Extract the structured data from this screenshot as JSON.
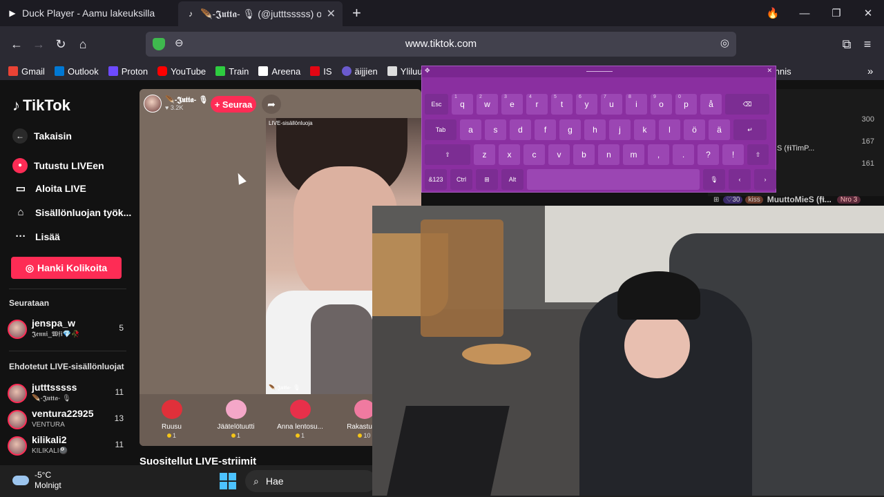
{
  "tabs": [
    {
      "title": "Duck Player - Aamu lakeuksilla",
      "icon": "play-icon"
    },
    {
      "title": "🪶-𝕵𝖚𝖙𝖙𝖆- 🎙 (@jutttsssss) on",
      "icon": "tiktok-icon"
    }
  ],
  "url": "www.tiktok.com",
  "bookmarks": [
    {
      "label": "Gmail",
      "color": "#ea4335"
    },
    {
      "label": "Outlook",
      "color": "#0078d4"
    },
    {
      "label": "Proton",
      "color": "#6d4aff"
    },
    {
      "label": "YouTube",
      "color": "#ff0000"
    },
    {
      "label": "Train",
      "color": "#2ecc40"
    },
    {
      "label": "Areena",
      "color": "#ffffff"
    },
    {
      "label": "IS",
      "color": "#e30613"
    },
    {
      "label": "äijjien",
      "color": "#6a5acd"
    },
    {
      "label": "Yliluuta",
      "color": "#dddddd"
    }
  ],
  "bookmark_right": "Tennis",
  "sidebar": {
    "logo": "TikTok",
    "back": "Takaisin",
    "items": [
      {
        "label": "Tutustu LIVEen",
        "icon": "live-icon"
      },
      {
        "label": "Aloita LIVE",
        "icon": "camera-icon"
      },
      {
        "label": "Sisällönluojan työk...",
        "icon": "creator-icon"
      },
      {
        "label": "Lisää",
        "icon": "more-icon"
      }
    ],
    "coins_button": "Hanki Kolikoita",
    "following_title": "Seurataan",
    "following": [
      {
        "name": "jenspa_w",
        "sub": "𝕵𝖊𝖓𝖓𝖎_𝖂𝖋𝖎💎🥀",
        "count": "5"
      }
    ],
    "suggested_title": "Ehdotetut LIVE-sisällönluojat",
    "suggested": [
      {
        "name": "jutttsssss",
        "sub": "🪶-𝕵𝖚𝖙𝖙𝖆- 🎙",
        "count": "11"
      },
      {
        "name": "ventura22925",
        "sub": "VENTURA",
        "count": "13"
      },
      {
        "name": "kilikali2",
        "sub": "KILIKALI🎱",
        "count": "11"
      }
    ]
  },
  "live": {
    "host_name": "🪶-𝕵𝖚𝖙𝖙𝖆- 🎙",
    "host_likes": "♥ 3.2K",
    "follow_label": "+ Seuraa",
    "live_label": "LIVE-sisällönluoja",
    "video_name": "🪶-𝕵𝖚𝖙𝖙𝖆- 🎙",
    "gifts": [
      {
        "name": "Ruusu",
        "price": "1",
        "color": "#e0303a"
      },
      {
        "name": "Jäätelötuutti",
        "price": "1",
        "color": "#f4a7c8"
      },
      {
        "name": "Anna lentosu...",
        "price": "1",
        "color": "#e8304a"
      },
      {
        "name": "Rakastun...",
        "price": "10",
        "color": "#f07aa0"
      }
    ]
  },
  "recommended_title": "Suositellut LIVE-striimit",
  "board": {
    "values": [
      "300",
      "167",
      "161"
    ],
    "name_fragment": "S (𝖋𝖎TimP...",
    "bottom_name": "MuuttoMieS (𝖋𝖎...",
    "bottom_badge": "Nro 3",
    "bottom_score": "30",
    "bottom_tag": "kiss"
  },
  "keyboard": {
    "rows": [
      [
        "Esc",
        "q",
        "w",
        "e",
        "r",
        "t",
        "y",
        "u",
        "i",
        "o",
        "p",
        "å",
        "⌫"
      ],
      [
        "Tab",
        "a",
        "s",
        "d",
        "f",
        "g",
        "h",
        "j",
        "k",
        "l",
        "ö",
        "ä",
        "↵"
      ],
      [
        "⇧",
        "z",
        "x",
        "c",
        "v",
        "b",
        "n",
        "m",
        ",",
        ".",
        "?",
        "!",
        "⇧"
      ],
      [
        "&123",
        "Ctrl",
        "⊞",
        "Alt",
        "",
        "🎙",
        "‹",
        "›"
      ]
    ],
    "sups": {
      "w": "2",
      "e": "3",
      "r": "4",
      "t": "5",
      "y": "6",
      "u": "7",
      "i": "8",
      "o": "9",
      "p": "0",
      "q": "1"
    }
  },
  "taskbar": {
    "temp": "-5°C",
    "weather": "Molnigt",
    "search_placeholder": "Hae"
  }
}
